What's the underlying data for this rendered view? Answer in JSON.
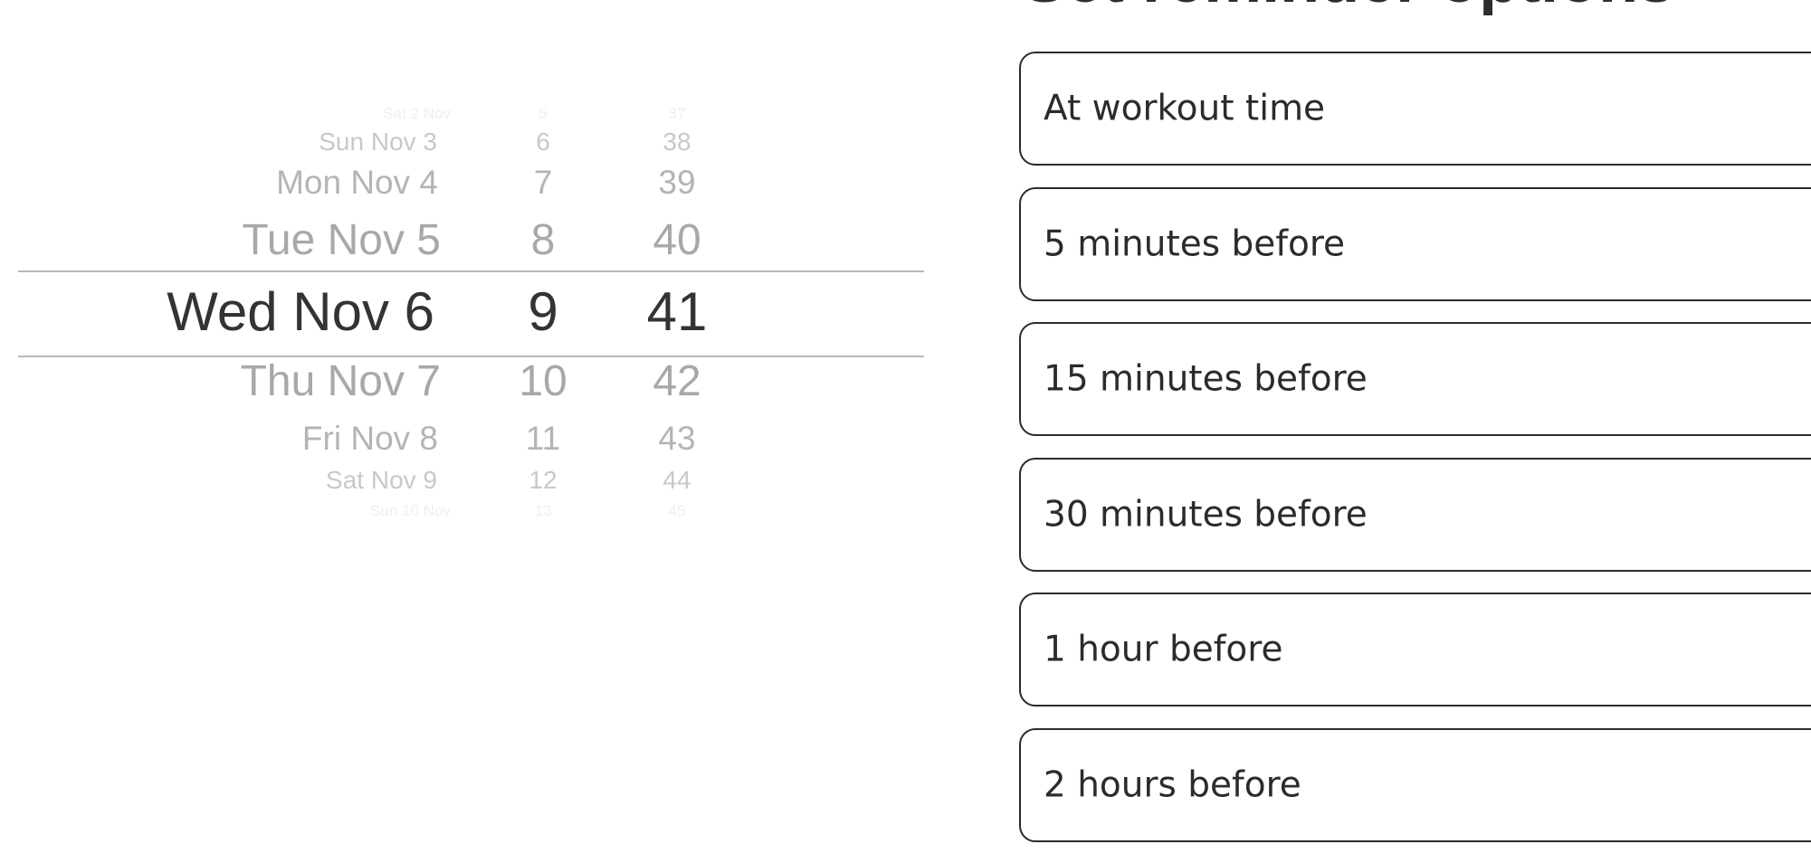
{
  "picker": {
    "rows": [
      {
        "date": "Sat 2 Nov",
        "hour": "5",
        "minute": "37",
        "tier": "t3"
      },
      {
        "date": "Sun Nov 3",
        "hour": "6",
        "minute": "38",
        "tier": "t2"
      },
      {
        "date": "Mon Nov 4",
        "hour": "7",
        "minute": "39",
        "tier": "t1"
      },
      {
        "date": "Tue Nov 5",
        "hour": "8",
        "minute": "40",
        "tier": "t0"
      },
      {
        "date": "Wed Nov 6",
        "hour": "9",
        "minute": "41",
        "tier": "sel"
      },
      {
        "date": "Thu Nov 7",
        "hour": "10",
        "minute": "42",
        "tier": "t0"
      },
      {
        "date": "Fri Nov 8",
        "hour": "11",
        "minute": "43",
        "tier": "t1"
      },
      {
        "date": "Sat Nov 9",
        "hour": "12",
        "minute": "44",
        "tier": "t2"
      },
      {
        "date": "Sun 10 Nov",
        "hour": "13",
        "minute": "45",
        "tier": "t3"
      }
    ]
  },
  "heading": "Set reminder options",
  "options": [
    {
      "label": "At workout time"
    },
    {
      "label": "5 minutes before"
    },
    {
      "label": "15 minutes before"
    },
    {
      "label": "30 minutes before"
    },
    {
      "label": "1 hour before"
    },
    {
      "label": "2 hours before"
    }
  ],
  "colors": {
    "selected_text": "#333333",
    "option_border": "#2b2b2b",
    "divider": "#b8b8b8"
  }
}
